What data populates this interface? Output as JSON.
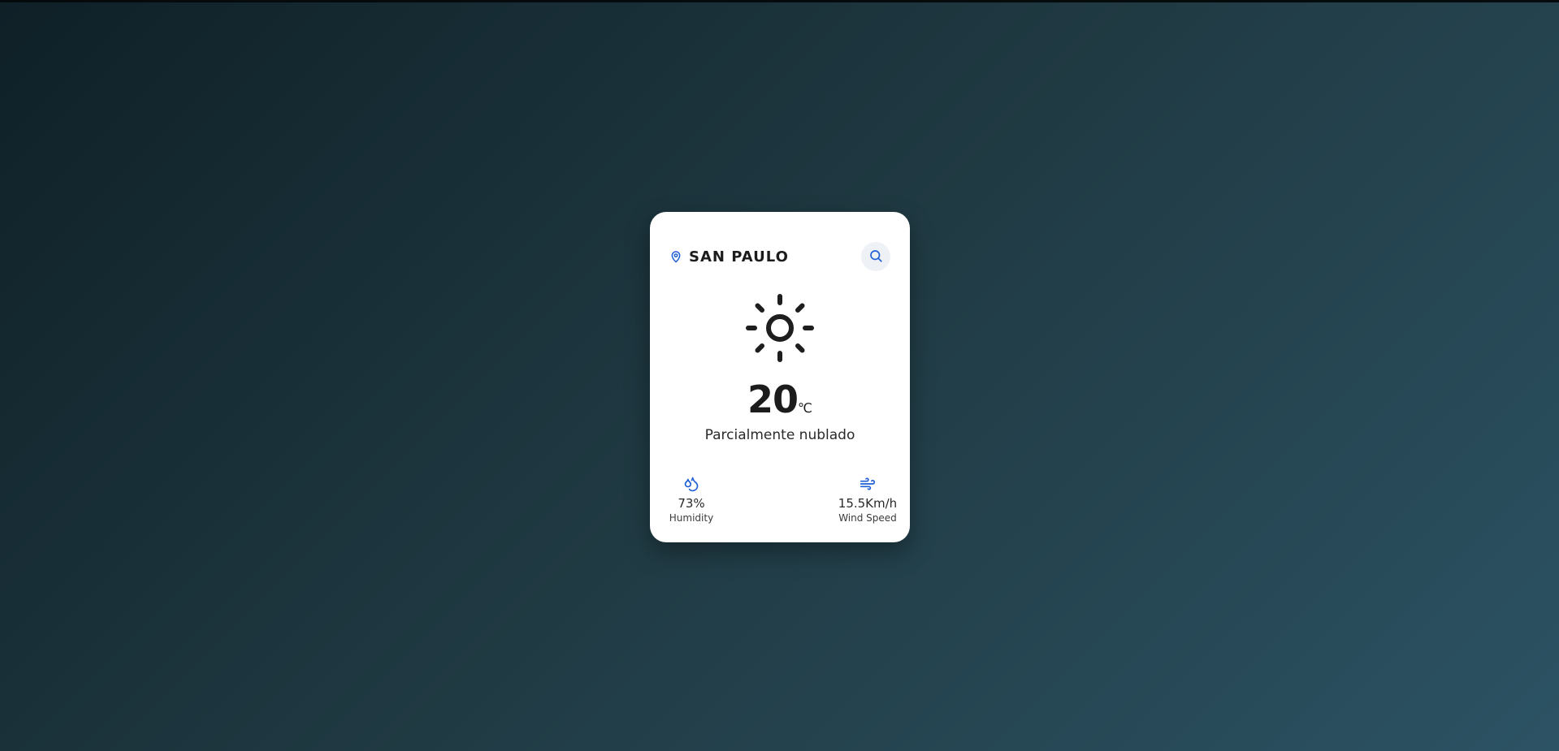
{
  "location": {
    "city": "SAN PAULO",
    "icon": "map-pin-icon"
  },
  "search": {
    "icon": "search-icon"
  },
  "weather": {
    "icon": "sun-icon",
    "temperature": "20",
    "unit": "℃",
    "description": "Parcialmente nublado"
  },
  "stats": {
    "humidity": {
      "icon": "droplets-icon",
      "value": "73%",
      "label": "Humidity"
    },
    "wind": {
      "icon": "wind-icon",
      "value": "15.5Km/h",
      "label": "Wind Speed"
    }
  },
  "colors": {
    "accent": "#1f5fd6",
    "text": "#1c1c1c",
    "card": "#ffffff",
    "background_start": "#0f2027",
    "background_end": "#2c5364"
  }
}
